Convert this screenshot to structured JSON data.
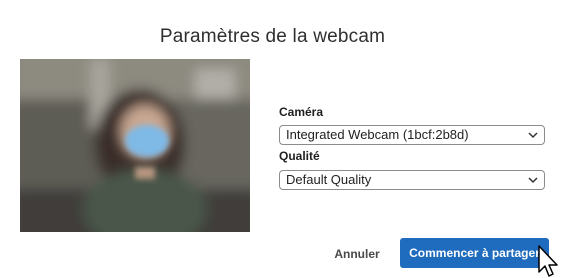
{
  "dialog": {
    "title": "Paramètres de la webcam"
  },
  "camera": {
    "label": "Caméra",
    "selected": "Integrated Webcam (1bcf:2b8d)"
  },
  "quality": {
    "label": "Qualité",
    "selected": "Default Quality"
  },
  "actions": {
    "cancel_label": "Annuler",
    "start_label": "Commencer à partager"
  },
  "colors": {
    "primary": "#1f6bbd",
    "mask": "#7fb9e6"
  },
  "icons": {
    "select_chevron": "chevron-down-icon",
    "cursor": "mouse-pointer-icon"
  }
}
